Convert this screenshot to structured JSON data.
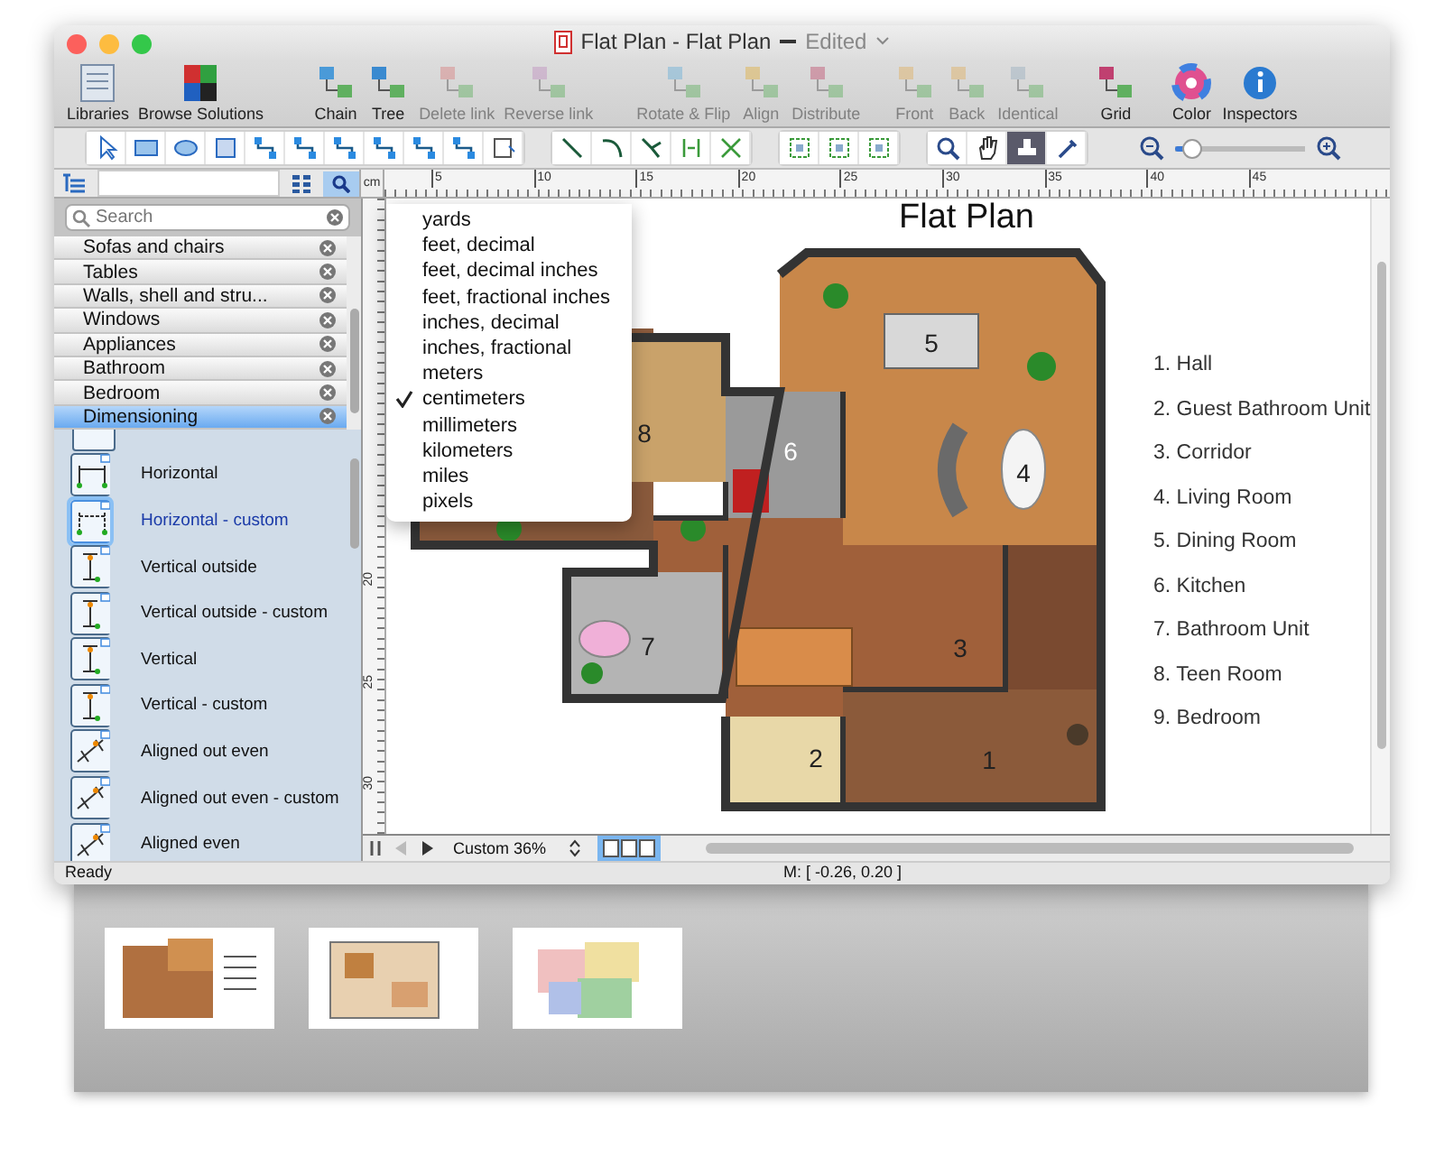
{
  "window": {
    "title": "Flat Plan - Flat Plan",
    "status": "Edited"
  },
  "toolbar": {
    "groups": [
      [
        {
          "label": "Libraries",
          "disabled": false
        },
        {
          "label": "Browse Solutions",
          "disabled": false
        }
      ],
      [
        {
          "label": "Chain",
          "disabled": false
        },
        {
          "label": "Tree",
          "disabled": false
        },
        {
          "label": "Delete link",
          "disabled": true
        },
        {
          "label": "Reverse link",
          "disabled": true
        }
      ],
      [
        {
          "label": "Rotate & Flip",
          "disabled": true
        },
        {
          "label": "Align",
          "disabled": true
        },
        {
          "label": "Distribute",
          "disabled": true
        }
      ],
      [
        {
          "label": "Front",
          "disabled": true
        },
        {
          "label": "Back",
          "disabled": true
        },
        {
          "label": "Identical",
          "disabled": true
        }
      ],
      [
        {
          "label": "Grid",
          "disabled": false
        }
      ],
      [
        {
          "label": "Color",
          "disabled": false
        },
        {
          "label": "Inspectors",
          "disabled": false
        }
      ]
    ]
  },
  "tools": [
    [
      {
        "kind": "pointer",
        "selected": false
      },
      {
        "kind": "rect",
        "selected": false
      },
      {
        "kind": "ellipse",
        "selected": false
      },
      {
        "kind": "container",
        "selected": false
      },
      {
        "kind": "connector",
        "selected": false
      },
      {
        "kind": "connector",
        "selected": false
      },
      {
        "kind": "connector",
        "selected": false
      },
      {
        "kind": "connector",
        "selected": false
      },
      {
        "kind": "connector",
        "selected": false
      },
      {
        "kind": "connector",
        "selected": false
      },
      {
        "kind": "insert",
        "selected": false
      }
    ],
    [
      {
        "kind": "line",
        "selected": false
      },
      {
        "kind": "arc",
        "selected": false
      },
      {
        "kind": "curve",
        "selected": false
      },
      {
        "kind": "split",
        "selected": false
      },
      {
        "kind": "join",
        "selected": false
      }
    ],
    [
      {
        "kind": "snap",
        "selected": false
      },
      {
        "kind": "snap",
        "selected": false
      },
      {
        "kind": "snap",
        "selected": false
      }
    ],
    [
      {
        "kind": "zoom",
        "selected": false
      },
      {
        "kind": "hand",
        "selected": false
      },
      {
        "kind": "stamp",
        "selected": true
      },
      {
        "kind": "pipette",
        "selected": false
      }
    ]
  ],
  "zoom_slider": {
    "level": 0.12
  },
  "sidebar": {
    "view_buttons": [
      {
        "kind": "grid",
        "selected": false
      },
      {
        "kind": "search",
        "selected": true
      }
    ],
    "search": {
      "placeholder": "Search"
    },
    "libraries": [
      {
        "label": "Sofas and chairs",
        "selected": false
      },
      {
        "label": "Tables",
        "selected": false
      },
      {
        "label": "Walls, shell and stru...",
        "selected": false
      },
      {
        "label": "Windows",
        "selected": false
      },
      {
        "label": "Appliances",
        "selected": false
      },
      {
        "label": "Bathroom",
        "selected": false
      },
      {
        "label": "Bedroom",
        "selected": false
      },
      {
        "label": "Dimensioning",
        "selected": true
      }
    ],
    "shapes": [
      {
        "label": "Horizontal",
        "selected": false
      },
      {
        "label": "Horizontal - custom",
        "selected": true
      },
      {
        "label": "Vertical outside",
        "selected": false
      },
      {
        "label": "Vertical outside - custom",
        "selected": false
      },
      {
        "label": "Vertical",
        "selected": false
      },
      {
        "label": "Vertical - custom",
        "selected": false
      },
      {
        "label": "Aligned out even",
        "selected": false
      },
      {
        "label": "Aligned out even - custom",
        "selected": false
      },
      {
        "label": "Aligned even",
        "selected": false
      }
    ]
  },
  "ruler": {
    "unit": "cm",
    "top_labels": [
      "5",
      "10",
      "15",
      "20",
      "25",
      "30",
      "35",
      "40",
      "45"
    ],
    "left_labels": [
      "20",
      "25",
      "30"
    ]
  },
  "unit_menu": [
    {
      "label": "yards",
      "checked": false
    },
    {
      "label": "feet, decimal",
      "checked": false
    },
    {
      "label": "feet, decimal inches",
      "checked": false
    },
    {
      "label": "feet, fractional inches",
      "checked": false
    },
    {
      "label": "inches, decimal",
      "checked": false
    },
    {
      "label": "inches, fractional",
      "checked": false
    },
    {
      "label": "meters",
      "checked": false
    },
    {
      "label": "centimeters",
      "checked": true
    },
    {
      "label": "millimeters",
      "checked": false
    },
    {
      "label": "kilometers",
      "checked": false
    },
    {
      "label": "miles",
      "checked": false
    },
    {
      "label": "pixels",
      "checked": false
    }
  ],
  "plan": {
    "title": "Flat Plan",
    "room_numbers": [
      "1",
      "2",
      "3",
      "4",
      "5",
      "6",
      "7",
      "8"
    ],
    "legend": [
      "1. Hall",
      "2. Guest Bathroom Unit",
      "3. Corridor",
      "4. Living Room",
      "5. Dining Room",
      "6. Kitchen",
      "7. Bathroom Unit",
      "8. Teen Room",
      "9. Bedroom"
    ]
  },
  "bottom_bar": {
    "zoom": "Custom 36%"
  },
  "status_bar": {
    "state": "Ready",
    "mouse": "M: [ -0.26, 0.20 ]"
  }
}
